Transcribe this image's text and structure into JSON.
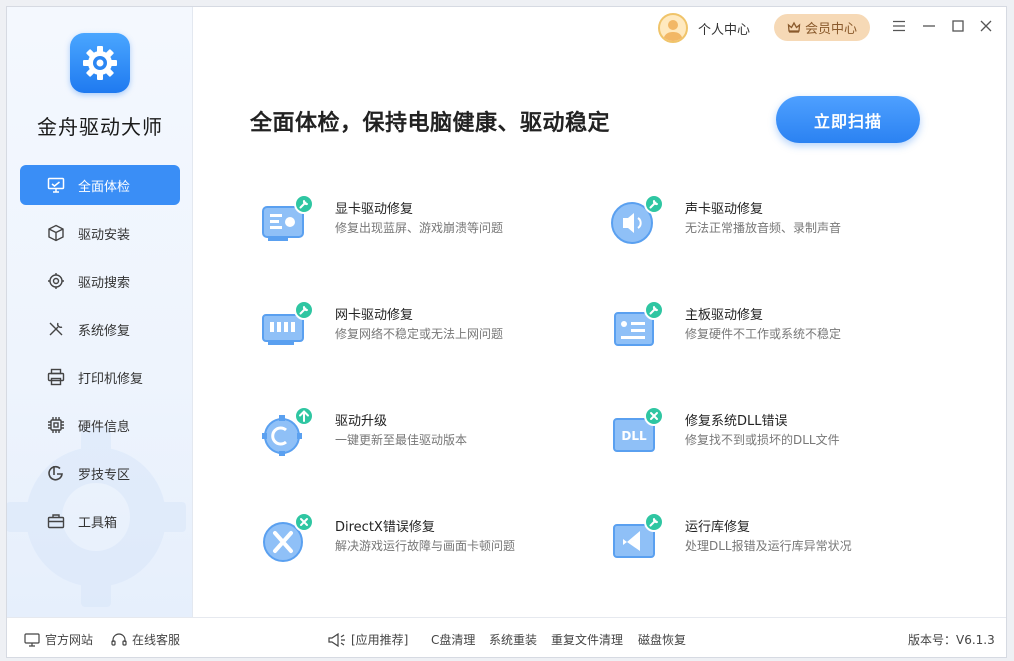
{
  "app": {
    "name": "金舟驱动大师"
  },
  "topbar": {
    "user_center": "个人中心",
    "vip_center": "会员中心"
  },
  "sidebar": {
    "items": [
      {
        "label": "全面体检",
        "icon": "monitor-check-icon",
        "active": true
      },
      {
        "label": "驱动安装",
        "icon": "cube-install-icon"
      },
      {
        "label": "驱动搜索",
        "icon": "gear-search-icon"
      },
      {
        "label": "系统修复",
        "icon": "wrench-tools-icon"
      },
      {
        "label": "打印机修复",
        "icon": "printer-icon"
      },
      {
        "label": "硬件信息",
        "icon": "chip-icon"
      },
      {
        "label": "罗技专区",
        "icon": "logitech-icon"
      },
      {
        "label": "工具箱",
        "icon": "toolbox-icon"
      }
    ]
  },
  "main": {
    "headline": "全面体检，保持电脑健康、驱动稳定",
    "scan_button": "立即扫描",
    "features": [
      {
        "title": "显卡驱动修复",
        "desc": "修复出现蓝屏、游戏崩溃等问题",
        "icon": "graphics-card-icon"
      },
      {
        "title": "声卡驱动修复",
        "desc": "无法正常播放音频、录制声音",
        "icon": "speaker-icon"
      },
      {
        "title": "网卡驱动修复",
        "desc": "修复网络不稳定或无法上网问题",
        "icon": "network-card-icon"
      },
      {
        "title": "主板驱动修复",
        "desc": "修复硬件不工作或系统不稳定",
        "icon": "motherboard-icon"
      },
      {
        "title": "驱动升级",
        "desc": "一键更新至最佳驱动版本",
        "icon": "upgrade-gear-icon"
      },
      {
        "title": "修复系统DLL错误",
        "desc": "修复找不到或损坏的DLL文件",
        "icon": "dll-icon"
      },
      {
        "title": "DirectX错误修复",
        "desc": "解决游戏运行故障与画面卡顿问题",
        "icon": "directx-icon"
      },
      {
        "title": "运行库修复",
        "desc": "处理DLL报错及运行库异常状况",
        "icon": "runtime-library-icon"
      }
    ]
  },
  "footer": {
    "website": "官方网站",
    "support": "在线客服",
    "recommend": "[应用推荐]",
    "links": [
      "C盘清理",
      "系统重装",
      "重复文件清理",
      "磁盘恢复"
    ],
    "version_label": "版本号：",
    "version": "V6.1.3"
  },
  "colors": {
    "accent": "#3a8ef6",
    "vip_bg": "#f6d9b6",
    "icon_light": "#8fc0f7"
  }
}
